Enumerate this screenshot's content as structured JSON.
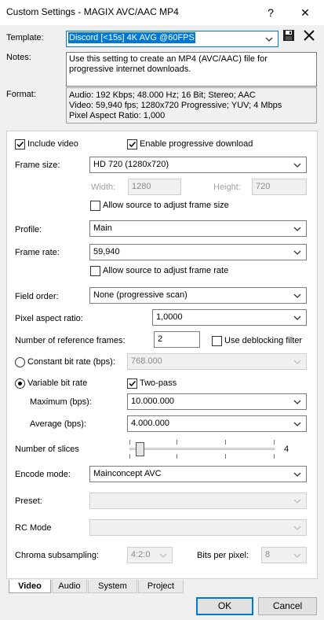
{
  "window": {
    "title": "Custom Settings - MAGIX AVC/AAC MP4",
    "help": "?",
    "close": "✕"
  },
  "template": {
    "label": "Template:",
    "value": "Discord [<15s] 4K AVG @60FPS"
  },
  "notes": {
    "label": "Notes:",
    "line1": "Use this setting to create an MP4 (AVC/AAC) file for",
    "line2": "progressive internet downloads."
  },
  "format": {
    "label": "Format:",
    "line1": "Audio: 192 Kbps; 48.000 Hz; 16 Bit; Stereo; AAC",
    "line2": "Video: 59,940 fps; 1280x720 Progressive; YUV; 4 Mbps",
    "line3": "Pixel Aspect Ratio: 1,000"
  },
  "video": {
    "include_video": "Include video",
    "enable_progressive": "Enable progressive download",
    "frame_size_label": "Frame size:",
    "frame_size": "HD 720 (1280x720)",
    "width_label": "Width:",
    "width": "1280",
    "height_label": "Height:",
    "height": "720",
    "allow_frame_size": "Allow source to adjust frame size",
    "profile_label": "Profile:",
    "profile": "Main",
    "frame_rate_label": "Frame rate:",
    "frame_rate": "59,940",
    "allow_frame_rate": "Allow source to adjust frame rate",
    "field_order_label": "Field order:",
    "field_order": "None (progressive scan)",
    "par_label": "Pixel aspect ratio:",
    "par": "1,0000",
    "ref_frames_label": "Number of reference frames:",
    "ref_frames": "2",
    "deblocking": "Use deblocking filter",
    "cbr_label": "Constant bit rate (bps):",
    "cbr": "768.000",
    "vbr_label": "Variable bit rate",
    "two_pass": "Two-pass",
    "max_label": "Maximum (bps):",
    "max": "10.000.000",
    "avg_label": "Average (bps):",
    "avg": "4.000.000",
    "slices_label": "Number of slices",
    "slices": "4",
    "slices_fraction": 0.0,
    "encode_mode_label": "Encode mode:",
    "encode_mode": "Mainconcept AVC",
    "preset_label": "Preset:",
    "rc_mode_label": "RC Mode",
    "chroma_label": "Chroma subsampling:",
    "chroma": "4:2:0",
    "bpp_label": "Bits per pixel:",
    "bpp": "8"
  },
  "tabs": [
    "Video",
    "Audio",
    "System",
    "Project"
  ],
  "buttons": {
    "ok": "OK",
    "cancel": "Cancel"
  },
  "colors": {
    "accent": "#0078d7",
    "selection": "#0078d7"
  }
}
